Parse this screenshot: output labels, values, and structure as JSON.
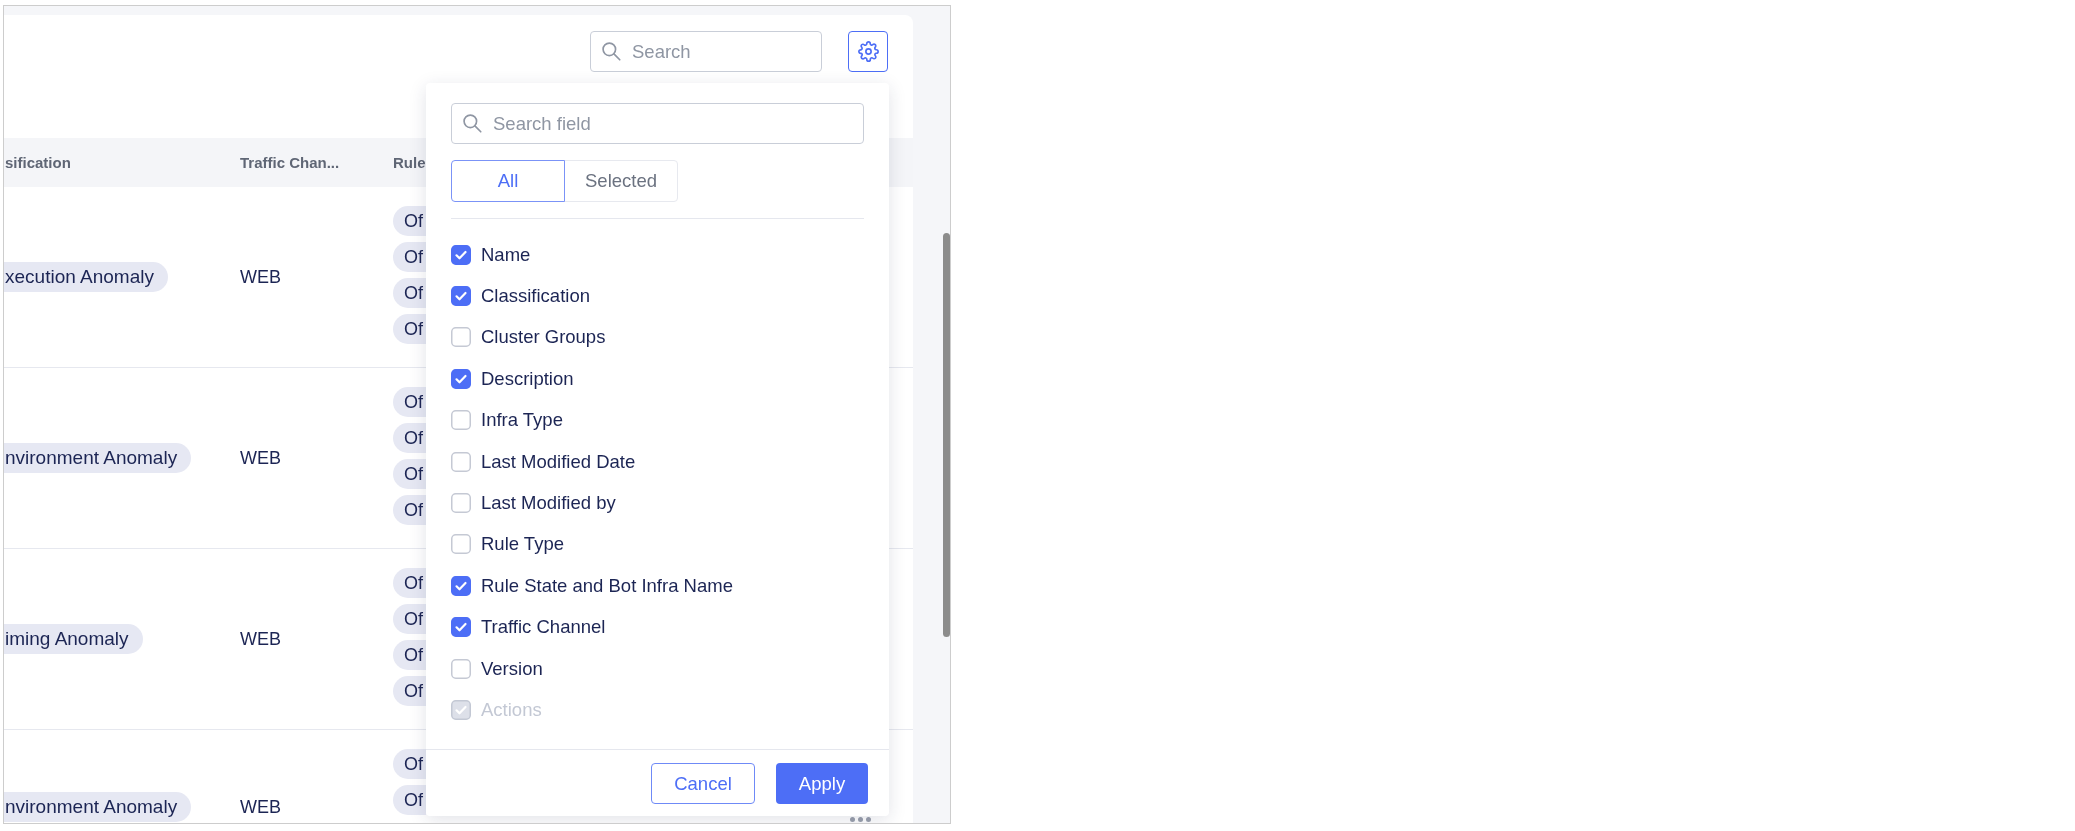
{
  "toolbar": {
    "search": {
      "placeholder": "Search"
    }
  },
  "table": {
    "columns": [
      "sification",
      "Traffic Chan...",
      "Rule"
    ],
    "rows": [
      {
        "column_1": "xecution Anomaly",
        "column_2": "WEB",
        "column_3": [
          "Of",
          "Of",
          "Of",
          "Of"
        ]
      },
      {
        "column_1": "nvironment Anomaly",
        "column_2": "WEB",
        "column_3": [
          "Of",
          "Of",
          "Of",
          "Of"
        ]
      },
      {
        "column_1": "iming Anomaly",
        "column_2": "WEB",
        "column_3": [
          "Of",
          "Of",
          "Of",
          "Of"
        ]
      },
      {
        "column_1": "nvironment Anomaly",
        "column_2": "WEB",
        "column_3": [
          "Of",
          "Of"
        ]
      }
    ]
  },
  "column_picker": {
    "search": {
      "placeholder": "Search field"
    },
    "filters": [
      {
        "label": "All",
        "selected": true
      },
      {
        "label": "Selected",
        "selected": false
      }
    ],
    "fields": [
      {
        "label": "Name",
        "checked": true,
        "disabled": false
      },
      {
        "label": "Classification",
        "checked": true,
        "disabled": false
      },
      {
        "label": "Cluster Groups",
        "checked": false,
        "disabled": false
      },
      {
        "label": "Description",
        "checked": true,
        "disabled": false
      },
      {
        "label": "Infra Type",
        "checked": false,
        "disabled": false
      },
      {
        "label": "Last Modified Date",
        "checked": false,
        "disabled": false
      },
      {
        "label": "Last Modified by",
        "checked": false,
        "disabled": false
      },
      {
        "label": "Rule Type",
        "checked": false,
        "disabled": false
      },
      {
        "label": "Rule State and Bot Infra Name",
        "checked": true,
        "disabled": false
      },
      {
        "label": "Traffic Channel",
        "checked": true,
        "disabled": false
      },
      {
        "label": "Version",
        "checked": false,
        "disabled": false
      },
      {
        "label": "Actions",
        "checked": true,
        "disabled": true
      }
    ],
    "buttons": [
      {
        "label": "Cancel",
        "kind": "secondary"
      },
      {
        "label": "Apply",
        "kind": "primary"
      }
    ]
  }
}
